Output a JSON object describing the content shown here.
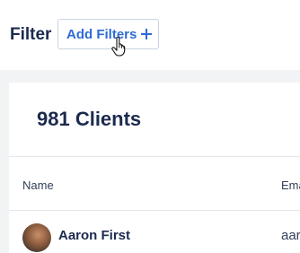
{
  "toolbar": {
    "filter_label": "Filter",
    "add_filters_label": "Add Filters"
  },
  "clients": {
    "title": "981 Clients",
    "columns": [
      "Name",
      "Ema"
    ],
    "rows": [
      {
        "name": "Aaron First",
        "email": "aar"
      }
    ]
  },
  "colors": {
    "accent": "#2d6bd6",
    "text_dark": "#1b2a4e"
  }
}
